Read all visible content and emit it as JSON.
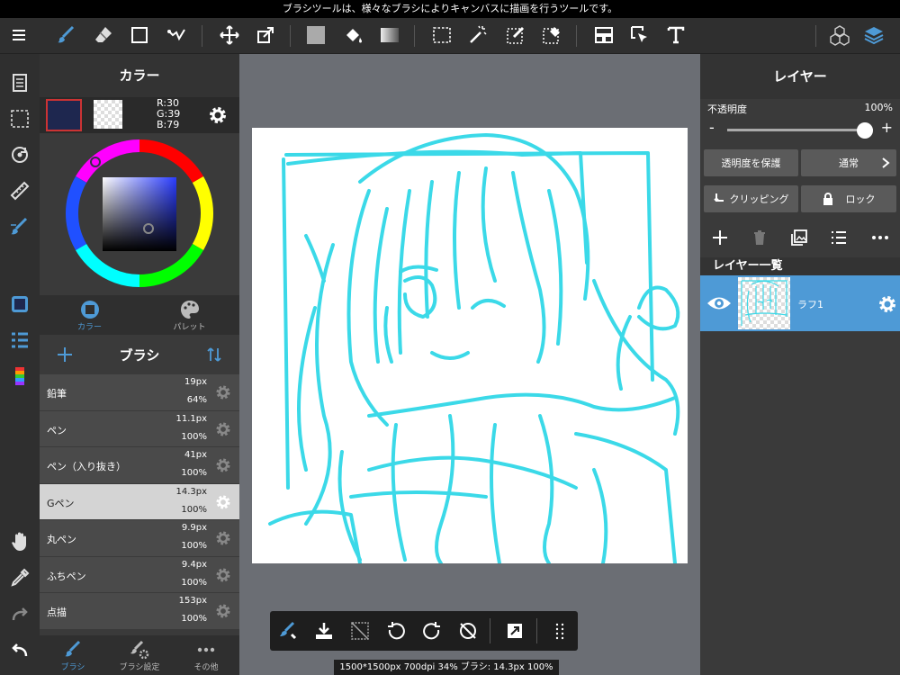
{
  "hint": "ブラシツールは、様々なブラシによりキャンバスに描画を行うツールです。",
  "color_panel": {
    "title": "カラー",
    "r": "R:30",
    "g": "G:39",
    "b": "B:79",
    "main_color": "#1e274f"
  },
  "color_tabs": [
    {
      "label": "カラー",
      "active": true
    },
    {
      "label": "パレット",
      "active": false
    }
  ],
  "brush_panel": {
    "title": "ブラシ",
    "items": [
      {
        "name": "鉛筆",
        "size": "19px",
        "opacity": "64%",
        "selected": false
      },
      {
        "name": "ペン",
        "size": "11.1px",
        "opacity": "100%",
        "selected": false
      },
      {
        "name": "ペン（入り抜き）",
        "size": "41px",
        "opacity": "100%",
        "selected": false
      },
      {
        "name": "Gペン",
        "size": "14.3px",
        "opacity": "100%",
        "selected": true
      },
      {
        "name": "丸ペン",
        "size": "9.9px",
        "opacity": "100%",
        "selected": false
      },
      {
        "name": "ふちペン",
        "size": "9.4px",
        "opacity": "100%",
        "selected": false
      },
      {
        "name": "点描",
        "size": "153px",
        "opacity": "100%",
        "selected": false
      }
    ]
  },
  "bottom_tabs": [
    {
      "label": "ブラシ"
    },
    {
      "label": "ブラシ設定"
    },
    {
      "label": "その他"
    }
  ],
  "status": "1500*1500px 700dpi 34% ブラシ: 14.3px 100%",
  "layer_panel": {
    "title": "レイヤー",
    "opacity_label": "不透明度",
    "opacity_value": "100%",
    "opacity_fraction": 1.0,
    "protect_label": "透明度を保護",
    "blend_label": "通常",
    "clipping_label": "クリッピング",
    "lock_label": "ロック",
    "list_header": "レイヤー一覧",
    "layers": [
      {
        "name": "ラフ1"
      }
    ]
  },
  "colors": {
    "accent": "#4e9ad6",
    "sketch": "#3bd9e8"
  }
}
